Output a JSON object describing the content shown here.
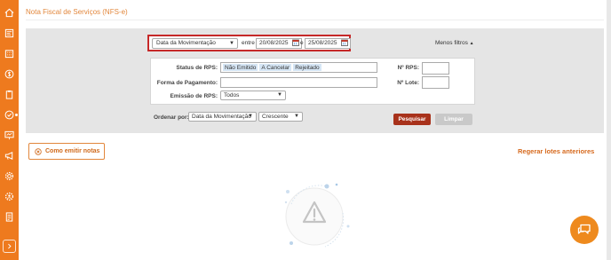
{
  "page": {
    "title": "Nota Fiscal de Serviços (NFS-e)"
  },
  "sidebar": {
    "items": [
      {
        "icon": "home-icon"
      },
      {
        "icon": "document-register-icon"
      },
      {
        "icon": "building-icon"
      },
      {
        "icon": "dollar-icon"
      },
      {
        "icon": "clipboard-icon"
      },
      {
        "icon": "check-circle-icon"
      },
      {
        "icon": "presentation-icon"
      },
      {
        "icon": "megaphone-icon"
      },
      {
        "icon": "settings-gear-icon"
      },
      {
        "icon": "users-gear-icon"
      },
      {
        "icon": "document-list-icon"
      }
    ],
    "expand_icon": "chevron-right-icon"
  },
  "filters": {
    "period_select": "Data da Movimentação",
    "between_label": "entre",
    "date_from": "20/08/2025",
    "and_label": "e",
    "date_to": "25/08/2025",
    "less_filters_label": "Menos filtros",
    "status_label": "Status de RPS:",
    "status_tags": [
      "Não Emitido",
      "A Cancelar",
      "Rejeitado"
    ],
    "payment_label": "Forma de Pagamento:",
    "emission_label": "Emissão de RPS:",
    "emission_value": "Todos",
    "rps_number_label": "Nº RPS:",
    "lot_number_label": "Nº Lote:",
    "order_label": "Ordenar por:",
    "order_by": "Data da Movimentação",
    "order_direction": "Crescente",
    "search_button": "Pesquisar",
    "clear_button": "Limpar"
  },
  "actions": {
    "how_to_label": "Como emitir notas",
    "regenerate_label": "Regerar lotes anteriores"
  },
  "colors": {
    "brand_orange": "#ee7a1e",
    "search_button": "#a8321b",
    "highlight_border": "#c62828"
  }
}
